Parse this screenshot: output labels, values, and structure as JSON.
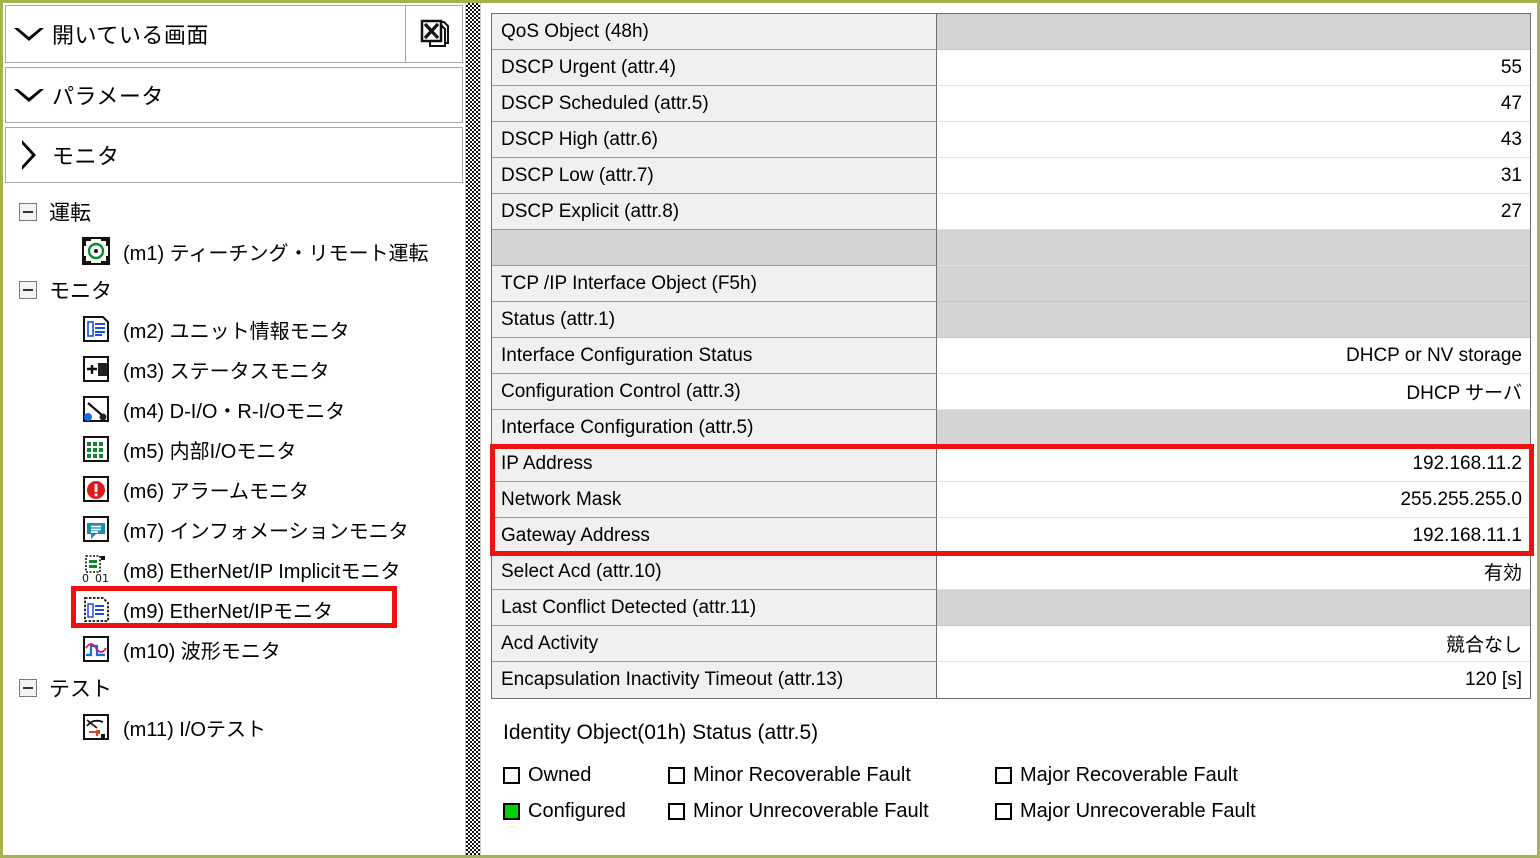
{
  "colors": {
    "frame_border": "#a6b14f",
    "highlight_red": "#ee1111",
    "name_cell_bg": "#f0f0f0",
    "gray_row_bg": "#d4d4d4",
    "checkbox_on": "#00d400"
  },
  "sidebar": {
    "bars": [
      {
        "label": "開いている画面",
        "arrow": "chevron-down-icon",
        "tool_icon": "close-all-windows-icon"
      },
      {
        "label": "パラメータ",
        "arrow": "chevron-down-icon"
      },
      {
        "label": "モニタ",
        "arrow": "chevron-right-icon"
      }
    ],
    "tree": [
      {
        "group": "運転",
        "toggle": "collapse-minus-icon",
        "items": [
          {
            "id": "m1",
            "label": "(m1) ティーチング・リモート運転",
            "icon": "teaching-remote-icon",
            "highlighted": false
          }
        ]
      },
      {
        "group": "モニタ",
        "toggle": "collapse-minus-icon",
        "items": [
          {
            "id": "m2",
            "label": "(m2) ユニット情報モニタ",
            "icon": "unit-info-icon",
            "highlighted": false
          },
          {
            "id": "m3",
            "label": "(m3) ステータスモニタ",
            "icon": "status-monitor-icon",
            "highlighted": false
          },
          {
            "id": "m4",
            "label": "(m4) D-I/O・R-I/Oモニタ",
            "icon": "dio-rio-icon",
            "highlighted": false
          },
          {
            "id": "m5",
            "label": "(m5) 内部I/Oモニタ",
            "icon": "internal-io-icon",
            "highlighted": false
          },
          {
            "id": "m6",
            "label": "(m6) アラームモニタ",
            "icon": "alarm-icon",
            "highlighted": false
          },
          {
            "id": "m7",
            "label": "(m7) インフォメーションモニタ",
            "icon": "information-icon",
            "highlighted": false
          },
          {
            "id": "m8",
            "label": "(m8) EtherNet/IP Implicitモニタ",
            "icon": "ethernet-implicit-icon",
            "highlighted": false
          },
          {
            "id": "m9",
            "label": "(m9) EtherNet/IPモニタ",
            "icon": "ethernet-monitor-icon",
            "highlighted": true
          },
          {
            "id": "m10",
            "label": "(m10) 波形モニタ",
            "icon": "waveform-icon",
            "highlighted": false
          }
        ]
      },
      {
        "group": "テスト",
        "toggle": "collapse-minus-icon",
        "items": [
          {
            "id": "m11",
            "label": "(m11) I/Oテスト",
            "icon": "io-test-icon",
            "highlighted": false
          }
        ]
      }
    ]
  },
  "attribute_table": {
    "rows": [
      {
        "name": "QoS Object (48h)",
        "value": "",
        "style": "header"
      },
      {
        "name": "DSCP Urgent (attr.4)",
        "value": "55",
        "style": "value"
      },
      {
        "name": "DSCP Scheduled (attr.5)",
        "value": "47",
        "style": "value"
      },
      {
        "name": "DSCP High (attr.6)",
        "value": "43",
        "style": "value"
      },
      {
        "name": "DSCP Low (attr.7)",
        "value": "31",
        "style": "value"
      },
      {
        "name": "DSCP Explicit (attr.8)",
        "value": "27",
        "style": "value"
      },
      {
        "name": "",
        "value": "",
        "style": "separator"
      },
      {
        "name": "TCP /IP Interface Object (F5h)",
        "value": "",
        "style": "header"
      },
      {
        "name": "Status (attr.1)",
        "value": "",
        "style": "header"
      },
      {
        "name": "Interface Configuration Status",
        "value": "DHCP or NV storage",
        "style": "value"
      },
      {
        "name": "Configuration Control (attr.3)",
        "value": "DHCP サーバ",
        "style": "value"
      },
      {
        "name": "Interface Configuration (attr.5)",
        "value": "",
        "style": "header"
      },
      {
        "name": "IP Address",
        "value": "192.168.11.2",
        "style": "value"
      },
      {
        "name": "Network Mask",
        "value": "255.255.255.0",
        "style": "value"
      },
      {
        "name": "Gateway Address",
        "value": "192.168.11.1",
        "style": "value"
      },
      {
        "name": "Select Acd (attr.10)",
        "value": "有効",
        "style": "value"
      },
      {
        "name": "Last Conflict Detected (attr.11)",
        "value": "",
        "style": "header"
      },
      {
        "name": "Acd Activity",
        "value": "競合なし",
        "style": "value"
      },
      {
        "name": "Encapsulation Inactivity Timeout (attr.13)",
        "value": "120 [s]",
        "style": "value"
      }
    ],
    "highlight_rows": [
      12,
      13,
      14
    ]
  },
  "status_block": {
    "title": "Identity Object(01h) Status (attr.5)",
    "rows": [
      [
        {
          "label": "Owned",
          "checked": false
        },
        {
          "label": "Minor Recoverable Fault",
          "checked": false
        },
        {
          "label": "Major Recoverable Fault",
          "checked": false
        }
      ],
      [
        {
          "label": "Configured",
          "checked": true
        },
        {
          "label": "Minor Unrecoverable Fault",
          "checked": false
        },
        {
          "label": "Major Unrecoverable Fault",
          "checked": false
        }
      ]
    ]
  }
}
